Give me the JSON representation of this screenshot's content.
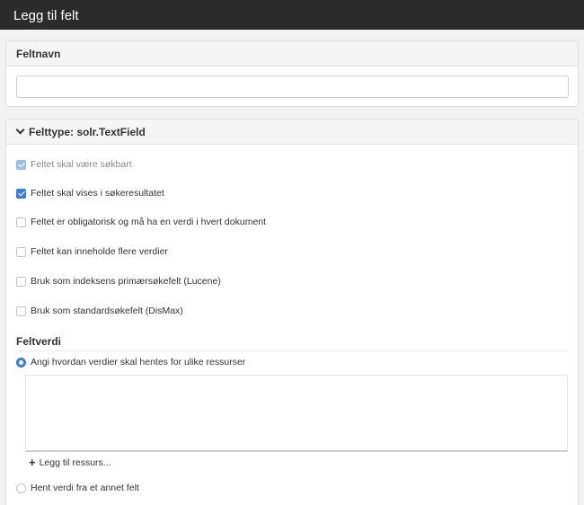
{
  "header": {
    "title": "Legg til felt"
  },
  "name_panel": {
    "title": "Feltnavn",
    "input_value": ""
  },
  "type_panel": {
    "title": "Felttype: solr.TextField",
    "options": [
      {
        "label": "Feltet skal være søkbart",
        "checked": true,
        "disabled": true
      },
      {
        "label": "Feltet skal vises i søkeresultatet",
        "checked": true,
        "disabled": false
      },
      {
        "label": "Feltet er obligatorisk og må ha en verdi i hvert dokument",
        "checked": false,
        "disabled": false
      },
      {
        "label": "Feltet kan inneholde flere verdier",
        "checked": false,
        "disabled": false
      },
      {
        "label": "Bruk som indeksens primærsøkefelt (Lucene)",
        "checked": false,
        "disabled": false
      },
      {
        "label": "Bruk som standardsøkefelt (DisMax)",
        "checked": false,
        "disabled": false
      }
    ],
    "value_section": {
      "title": "Feltverdi",
      "radio_resources": {
        "label": "Angi hvordan verdier skal hentes for ulike ressurser",
        "checked": true
      },
      "add_resource": "Legg til ressurs...",
      "radio_other_field": {
        "label": "Hent verdi fra et annet felt",
        "checked": false
      }
    }
  },
  "colors": {
    "accent": "#3a7bd5",
    "titlebar": "#2b2b2b"
  }
}
